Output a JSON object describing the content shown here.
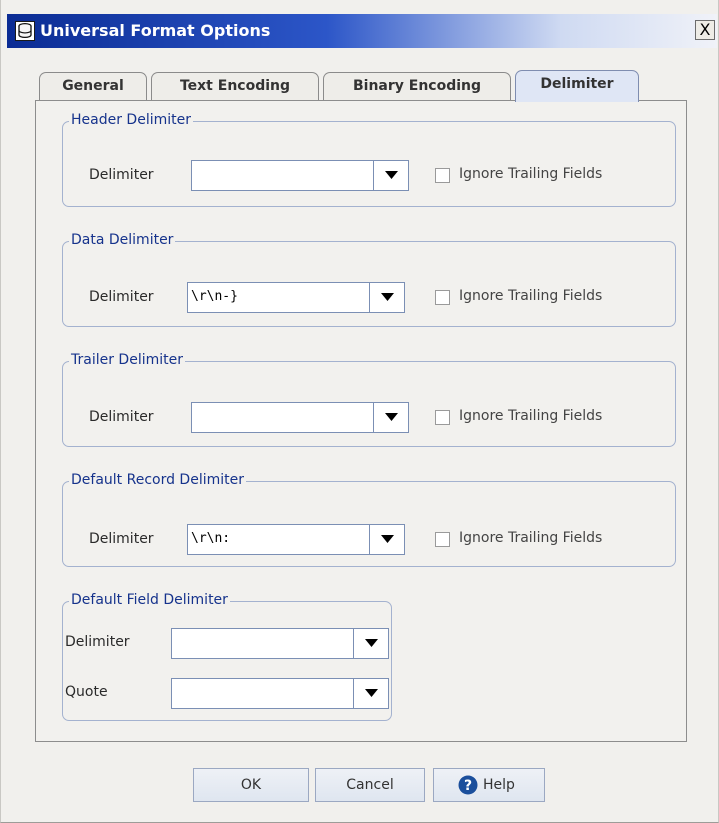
{
  "window": {
    "title": "Universal Format Options",
    "close_label": "X"
  },
  "tabs": [
    {
      "label": "General",
      "active": false
    },
    {
      "label": "Text Encoding",
      "active": false
    },
    {
      "label": "Binary Encoding",
      "active": false
    },
    {
      "label": "Delimiter",
      "active": true
    }
  ],
  "groups": {
    "header": {
      "title": "Header Delimiter",
      "delimiter_label": "Delimiter",
      "delimiter_value": "",
      "ignore_label": "Ignore Trailing Fields",
      "ignore_checked": false
    },
    "data": {
      "title": "Data Delimiter",
      "delimiter_label": "Delimiter",
      "delimiter_value": "\\r\\n-}",
      "ignore_label": "Ignore Trailing Fields",
      "ignore_checked": false
    },
    "trailer": {
      "title": "Trailer Delimiter",
      "delimiter_label": "Delimiter",
      "delimiter_value": "",
      "ignore_label": "Ignore Trailing Fields",
      "ignore_checked": false
    },
    "record": {
      "title": "Default Record Delimiter",
      "delimiter_label": "Delimiter",
      "delimiter_value": "\\r\\n:",
      "ignore_label": "Ignore Trailing Fields",
      "ignore_checked": false
    },
    "field": {
      "title": "Default Field Delimiter",
      "delimiter_label": "Delimiter",
      "delimiter_value": "",
      "quote_label": "Quote",
      "quote_value": ""
    }
  },
  "buttons": {
    "ok": "OK",
    "cancel": "Cancel",
    "help": "Help"
  },
  "colors": {
    "title_start": "#0b2c94",
    "title_end": "#f0f2f8",
    "legend_text": "#16338c",
    "group_border": "#a4b2cf",
    "help_icon": "#1b4f9c"
  }
}
